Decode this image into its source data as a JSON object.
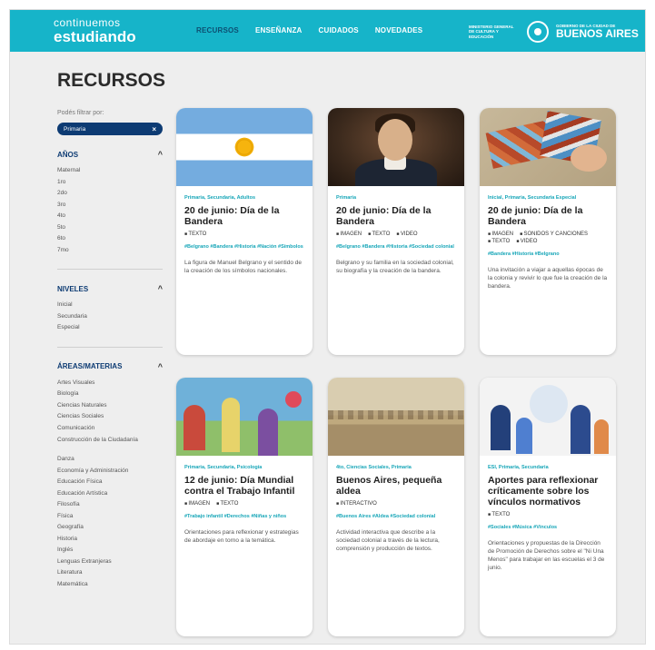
{
  "header": {
    "logo_line1": "continuemos",
    "logo_line2": "estudiando",
    "nav": [
      "RECURSOS",
      "ENSEÑANZA",
      "CUIDADOS",
      "NOVEDADES"
    ],
    "gov_small": "MINISTERIO GENERAL DE CULTURA Y EDUCACIÓN",
    "gov_city_small": "GOBIERNO DE LA CIUDAD DE",
    "gov_city": "BUENOS AIRES"
  },
  "page_title": "RECURSOS",
  "sidebar": {
    "filter_label": "Podés filtrar por:",
    "active_filter": "Primaria",
    "sections": [
      {
        "title": "AÑOS",
        "items": [
          "Maternal",
          "1ro",
          "2do",
          "3ro",
          "4to",
          "5to",
          "6to",
          "7mo"
        ]
      },
      {
        "title": "NIVELES",
        "items": [
          "Inicial",
          "Secundaria",
          "Especial"
        ]
      },
      {
        "title": "ÁREAS/MATERIAS",
        "items": [
          "Artes Visuales",
          "Biología",
          "Ciencias Naturales",
          "Ciencias Sociales",
          "Comunicación",
          "Construcción de la Ciudadanía",
          "Danza",
          "Economía y Administración",
          "Educación Física",
          "Educación Artística",
          "Filosofía",
          "Física",
          "Geografía",
          "Historia",
          "Inglés",
          "Lenguas Extranjeras",
          "Literatura",
          "Matemática"
        ]
      }
    ]
  },
  "cards": [
    {
      "tags": "Primaria, Secundaria, Adultos",
      "title": "20 de junio: Día de la Bandera",
      "types": [
        "TEXTO"
      ],
      "hashtags": "#Belgrano #Bandera #Historia #Nación #Símbolos",
      "desc": "La figura de Manuel Belgrano y el sentido de la creación de los símbolos nacionales."
    },
    {
      "tags": "Primaria",
      "title": "20 de junio: Día de la Bandera",
      "types": [
        "IMAGEN",
        "TEXTO",
        "VIDEO"
      ],
      "hashtags": "#Belgrano #Bandera #Historia #Sociedad colonial",
      "desc": "Belgrano y su familia en la sociedad colonial, su biografía y la creación de la bandera."
    },
    {
      "tags": "Inicial, Primaria, Secundaria Especial",
      "title": "20 de junio: Día de la Bandera",
      "types": [
        "IMAGEN",
        "SONIDOS Y CANCIONES",
        "TEXTO",
        "VIDEO"
      ],
      "hashtags": "#Bandera #Historia #Belgrano",
      "desc": "Una invitación a viajar a aquellas épocas de la colonia y revivir lo que fue la creación de la bandera."
    },
    {
      "tags": "Primaria, Secundaria, Psicología",
      "title": "12 de junio: Día Mundial contra el Trabajo Infantil",
      "types": [
        "IMAGEN",
        "TEXTO"
      ],
      "hashtags": "#Trabajo infantil #Derechos #Niñas y niños",
      "desc": "Orientaciones para reflexionar y estrategias de abordaje en torno a la temática."
    },
    {
      "tags": "4to, Ciencias Sociales, Primaria",
      "title": "Buenos Aires, pequeña aldea",
      "types": [
        "INTERACTIVO"
      ],
      "hashtags": "#Buenos Aires #Aldea #Sociedad colonial",
      "desc": "Actividad interactiva que describe a la sociedad colonial a través de la lectura, comprensión y producción de textos."
    },
    {
      "tags": "ESI, Primaria, Secundaria",
      "title": "Aportes para reflexionar críticamente sobre los vínculos normativos",
      "types": [
        "TEXTO"
      ],
      "hashtags": "#Sociales #Música #Vínculos",
      "desc": "Orientaciones y propuestas de la Dirección de Promoción de Derechos sobre el \"Ni Una Menos\" para trabajar en las escuelas el 3 de junio."
    }
  ]
}
